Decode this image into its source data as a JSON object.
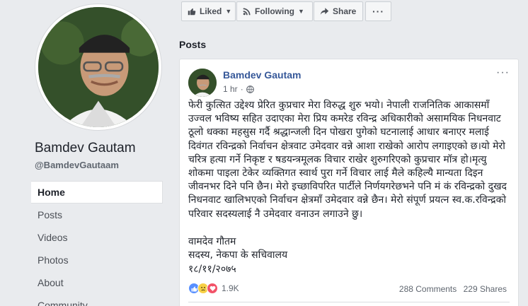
{
  "profile": {
    "name": "Bamdev Gautam",
    "handle": "@BamdevGautaam"
  },
  "nav": {
    "items": [
      "Home",
      "Posts",
      "Videos",
      "Photos",
      "About",
      "Community"
    ],
    "active": "Home"
  },
  "actions": {
    "liked_label": "Liked",
    "following_label": "Following",
    "share_label": "Share",
    "more_label": "···"
  },
  "posts_heading": "Posts",
  "post": {
    "author": "Bamdev Gautam",
    "time": "1 hr",
    "menu": "···",
    "body": "फेरी कुत्सित उद्देश्य प्रेरित कुप्रचार मेरा विरुद्ध शुरु भयो। नेपाली राजनितिक आकासमाँ उज्वल भविष्य सहित उदाएका मेरा प्रिय कमरेड रविन्द्र अधिकारीको असामयिक निधनवाट ठूलो धक्का महसुस गर्दै श्रद्धान्जली दिन पोखरा पुगेको घटनालाई आधार बनाएर मलाई दिवंगत रविन्द्रको निर्वाचन क्षेत्रवाट उमेदवार वन्ने आशा राखेको आरोप लगाइएको छ।यो मेरो चरित्र हत्या गर्ने निकृष्ट र षडयन्त्रमूलक विचार राखेर शुरुगरिएको कुप्रचार मॉत्र हो।मृत्यु शोकमा पाइला टेकेर व्यक्तिगत स्वार्थ पुरा गर्ने विचार लाई मैले कहिल्यै मान्यता दिइन जीवनभर दिने पनि छैन। मेरो इच्छाविपरित पार्टीले निर्णयगरेछभने पनि मं कं रविन्द्रको दुखद निधनवाट खालिभएको निर्वाचन क्षेत्रमाँ उमेदवार वन्ने छैन। मेरो संपूर्ण प्रयत्न स्व.क.रविन्द्रको परिवार सदस्यलाई नै उमेदवार वनाउन लगाउने छु।",
    "signature": "वामदेव गौतम",
    "designation": "सदस्य, नेकपा के सचिवालय",
    "date": "१८/११/२०७५",
    "reaction_count": "1.9K",
    "comments": "288 Comments",
    "shares": "229 Shares"
  },
  "colors": {
    "link": "#365899",
    "background": "#e9ebee",
    "like_blue": "#5890ff",
    "love_red": "#f25268",
    "sad_yellow": "#f7d046"
  }
}
